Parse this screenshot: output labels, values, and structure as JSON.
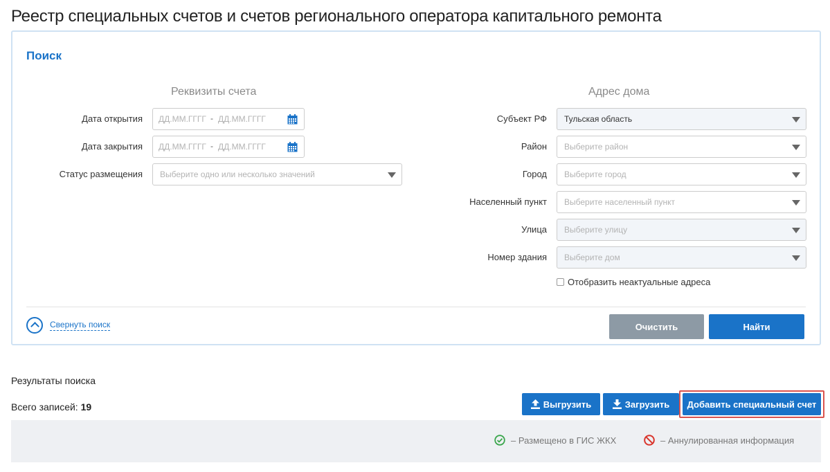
{
  "page": {
    "title": "Реестр специальных счетов и счетов регионального оператора капитального ремонта"
  },
  "search": {
    "title": "Поиск",
    "left_heading": "Реквизиты счета",
    "right_heading": "Адрес дома",
    "open_date": {
      "label": "Дата открытия",
      "from_placeholder": "ДД.ММ.ГГГГ",
      "sep": "-",
      "to_placeholder": "ДД.ММ.ГГГГ"
    },
    "close_date": {
      "label": "Дата закрытия",
      "from_placeholder": "ДД.ММ.ГГГГ",
      "sep": "-",
      "to_placeholder": "ДД.ММ.ГГГГ"
    },
    "status": {
      "label": "Статус размещения",
      "placeholder": "Выберите одно или несколько значений"
    },
    "region": {
      "label": "Субъект РФ",
      "value": "Тульская область"
    },
    "district": {
      "label": "Район",
      "placeholder": "Выберите район"
    },
    "city": {
      "label": "Город",
      "placeholder": "Выберите город"
    },
    "settlement": {
      "label": "Населенный пункт",
      "placeholder": "Выберите населенный пункт"
    },
    "street": {
      "label": "Улица",
      "placeholder": "Выберите улицу"
    },
    "building": {
      "label": "Номер здания",
      "placeholder": "Выберите дом"
    },
    "show_outdated": {
      "label": "Отобразить неактуальные адреса",
      "checked": false
    },
    "collapse_label": "Свернуть поиск",
    "clear_label": "Очистить",
    "find_label": "Найти"
  },
  "results": {
    "title": "Результаты поиска",
    "total_label": "Всего записей:",
    "total_count": "19",
    "export_label": "Выгрузить",
    "import_label": "Загрузить",
    "add_label": "Добавить специальный счет"
  },
  "legend": {
    "placed": "–  Размещено в ГИС ЖКХ",
    "cancelled": "–  Аннулированная информация"
  },
  "colors": {
    "accent": "#1a73c8",
    "clear_button": "#8d9aa5",
    "highlight": "#d9534f",
    "ok": "#3aa64c",
    "cancel": "#d9342b"
  }
}
